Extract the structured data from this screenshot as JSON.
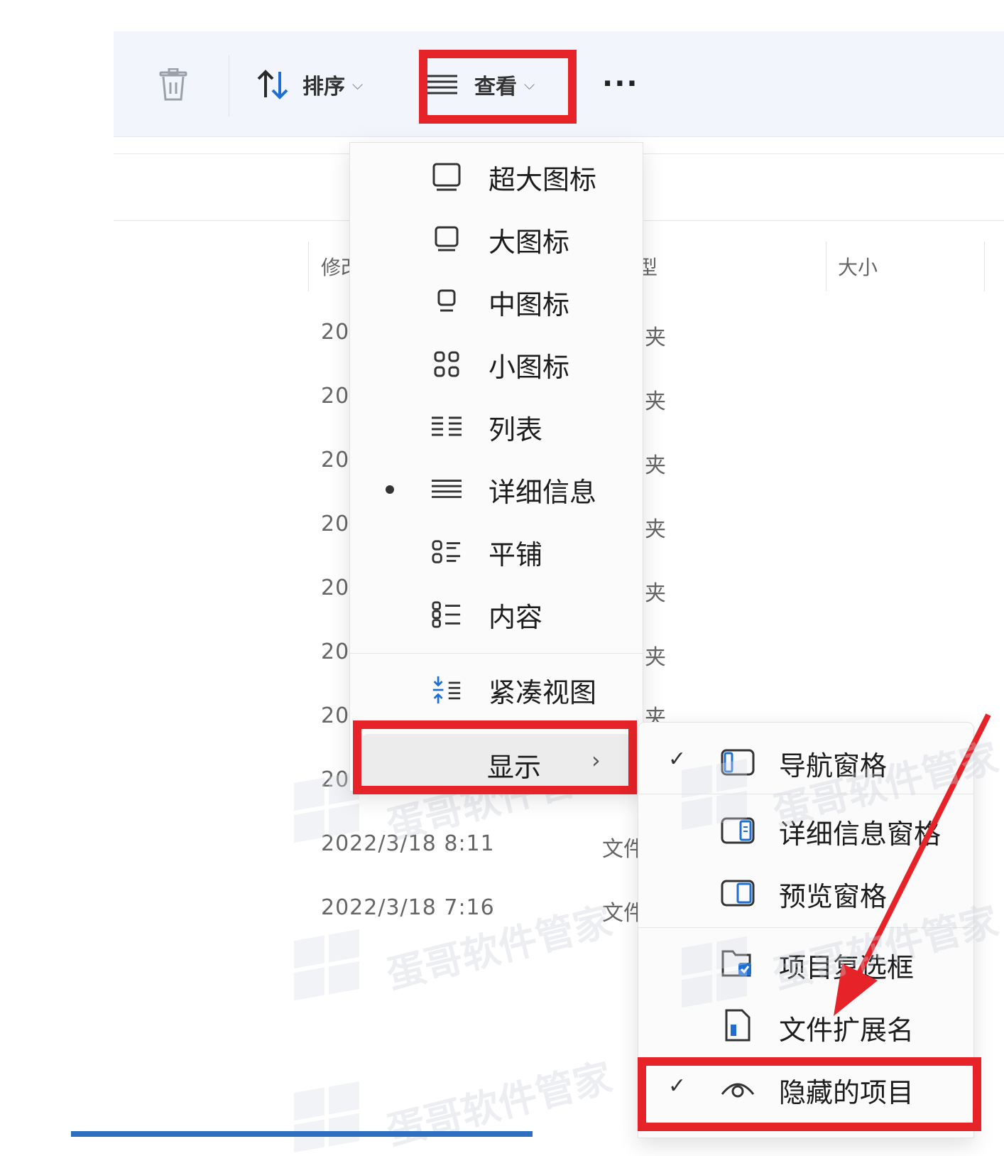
{
  "toolbar": {
    "sort_label": "排序",
    "view_label": "查看",
    "more_label": "···"
  },
  "columns": {
    "modified_partial": "修改",
    "type_partial": "型",
    "size": "大小"
  },
  "rows": [
    {
      "date": "20",
      "type": "夹"
    },
    {
      "date": "20",
      "type": "夹"
    },
    {
      "date": "20",
      "type": "夹"
    },
    {
      "date": "20",
      "type": "夹"
    },
    {
      "date": "20",
      "type": "夹"
    },
    {
      "date": "20",
      "type": "夹"
    },
    {
      "date": "20",
      "type": "夹"
    },
    {
      "date": "20",
      "type": ""
    },
    {
      "date": "2022/3/18 8:11",
      "type": "文件"
    },
    {
      "date": "2022/3/18 7:16",
      "type": "文件"
    }
  ],
  "view_menu": {
    "items": [
      {
        "label": "超大图标",
        "icon": "extra-large-icons-icon",
        "selected": false
      },
      {
        "label": "大图标",
        "icon": "large-icons-icon",
        "selected": false
      },
      {
        "label": "中图标",
        "icon": "medium-icons-icon",
        "selected": false
      },
      {
        "label": "小图标",
        "icon": "small-icons-icon",
        "selected": false
      },
      {
        "label": "列表",
        "icon": "list-icon",
        "selected": false
      },
      {
        "label": "详细信息",
        "icon": "details-icon",
        "selected": true
      },
      {
        "label": "平铺",
        "icon": "tiles-icon",
        "selected": false
      },
      {
        "label": "内容",
        "icon": "content-icon",
        "selected": false
      }
    ],
    "compact_label": "紧凑视图",
    "show_label": "显示"
  },
  "show_menu": {
    "items": [
      {
        "label": "导航窗格",
        "checked": true
      },
      {
        "label": "详细信息窗格",
        "checked": false
      },
      {
        "label": "预览窗格",
        "checked": false
      },
      {
        "label": "项目复选框",
        "checked": false
      },
      {
        "label": "文件扩展名",
        "checked": false
      },
      {
        "label": "隐藏的项目",
        "checked": true
      }
    ],
    "check_glyph": "✓"
  },
  "watermark": "蛋哥软件管家",
  "colors": {
    "highlight": "#e52328",
    "accent": "#1f6fd1",
    "arrow": "#e52328"
  }
}
